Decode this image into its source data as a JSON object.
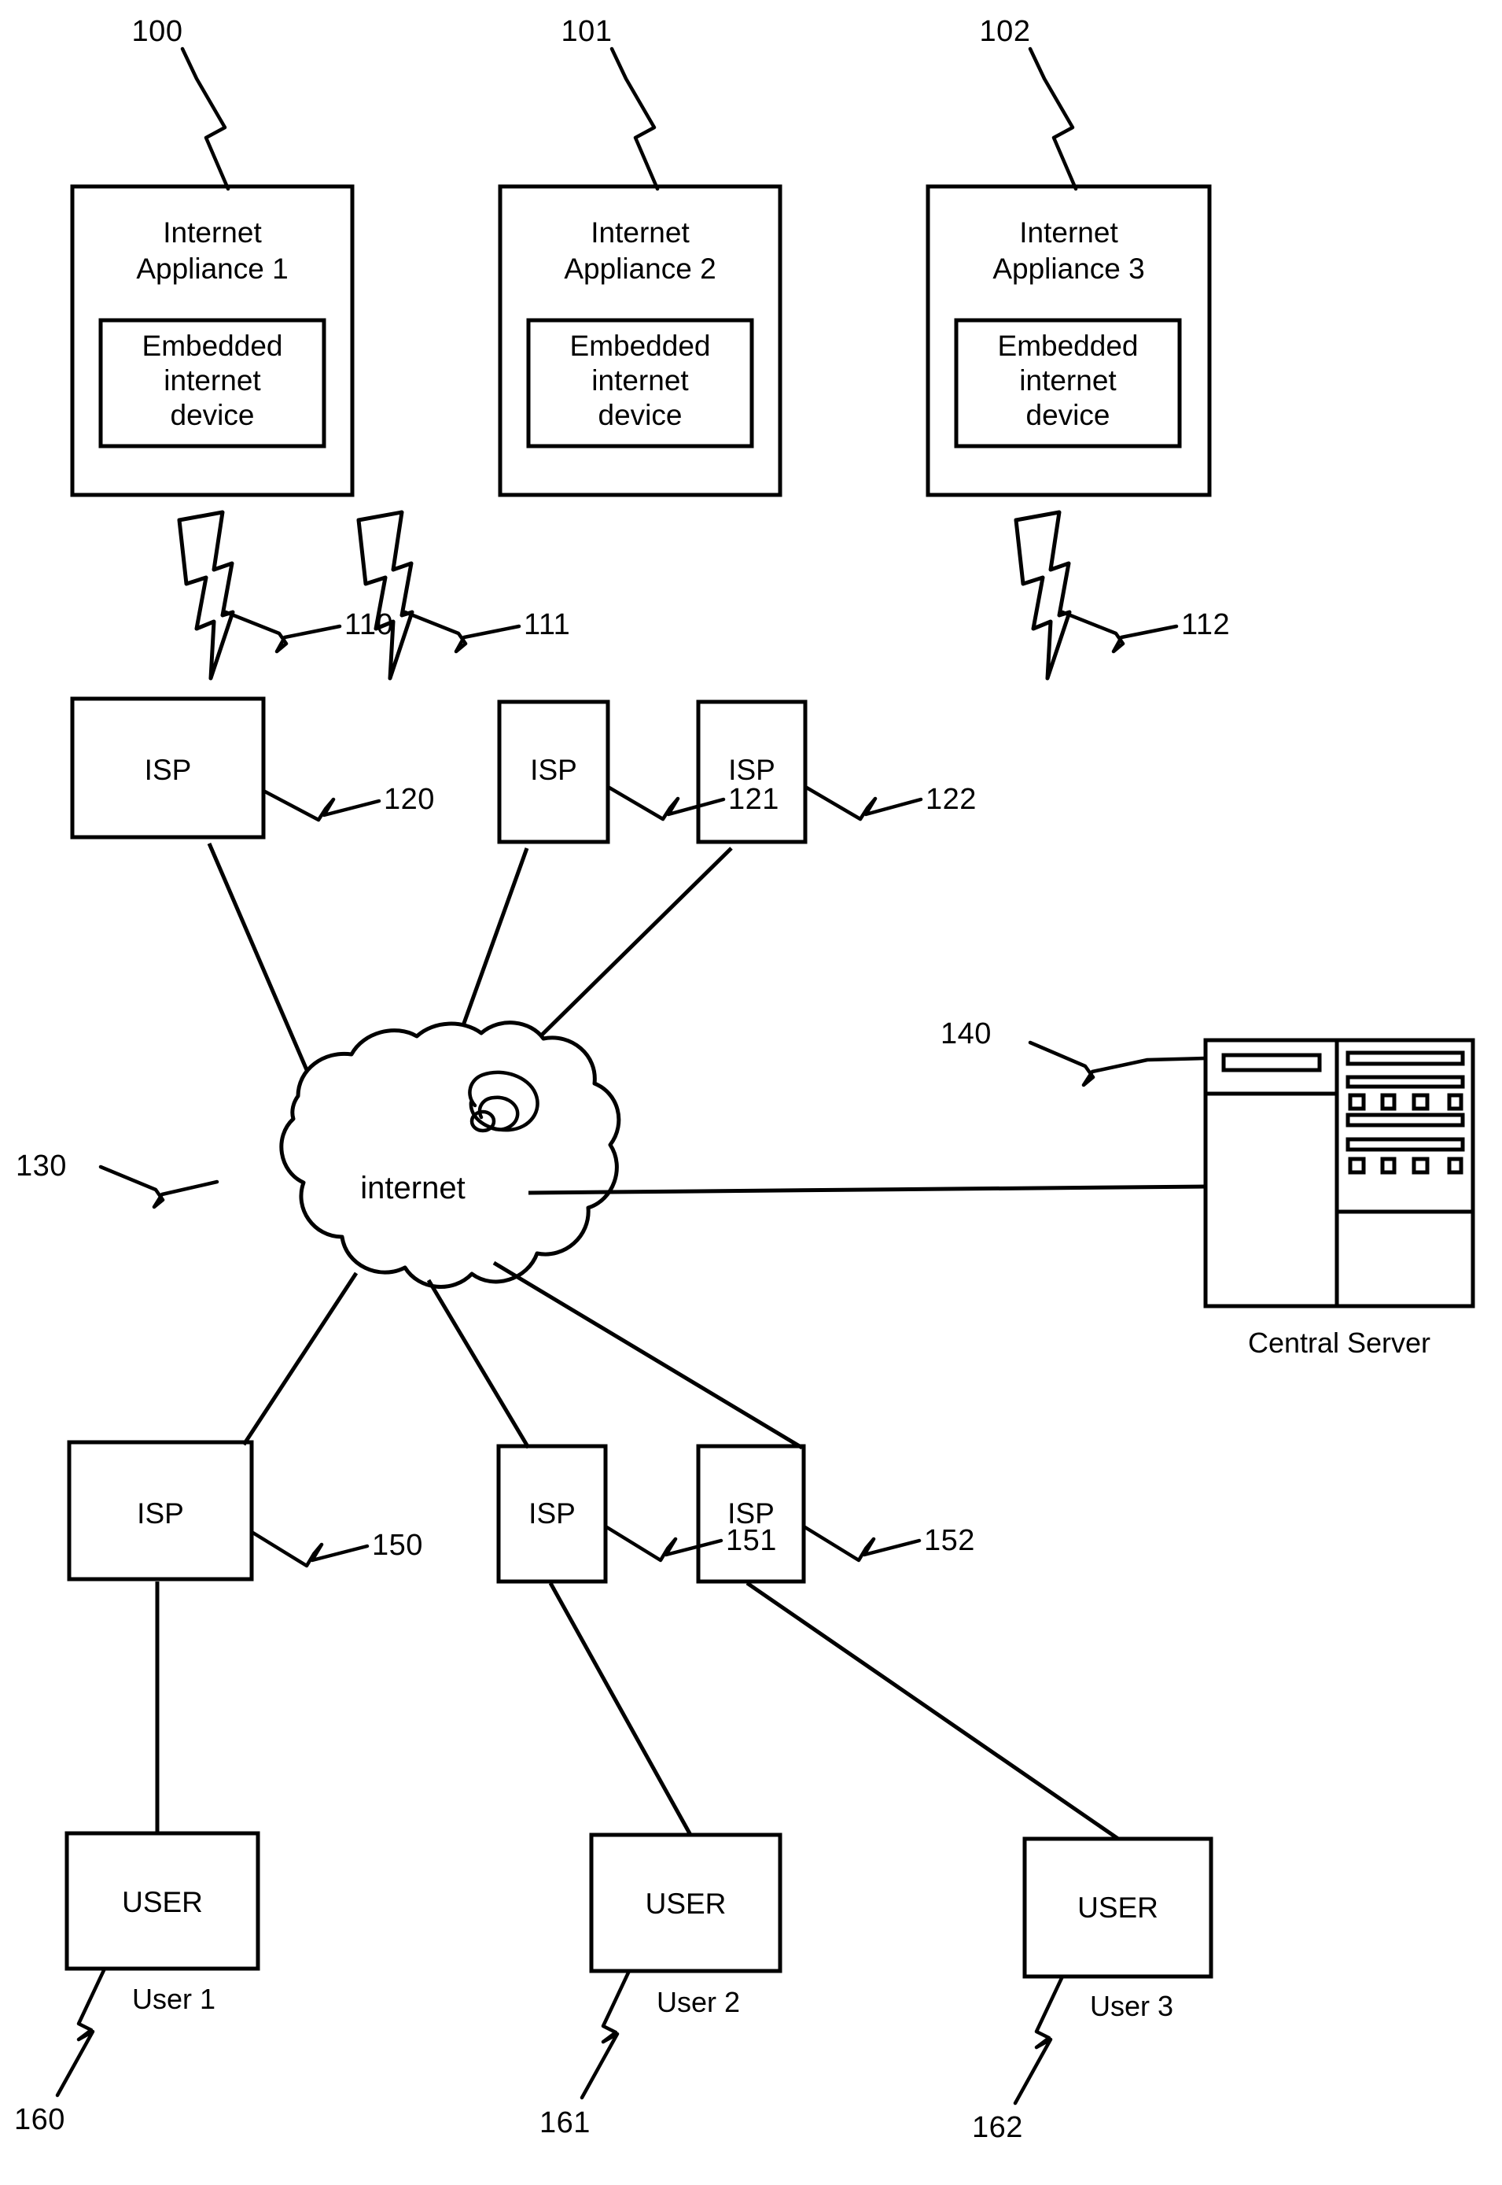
{
  "figure": {
    "kind": "patent-network-diagram",
    "ink_color": "#000000",
    "background_color": "#ffffff"
  },
  "appliances": [
    {
      "ref": "100",
      "title_line1": "Internet",
      "title_line2": "Appliance 1",
      "inner_line1": "Embedded",
      "inner_line2": "internet",
      "inner_line3": "device"
    },
    {
      "ref": "101",
      "title_line1": "Internet",
      "title_line2": "Appliance 2",
      "inner_line1": "Embedded",
      "inner_line2": "internet",
      "inner_line3": "device"
    },
    {
      "ref": "102",
      "title_line1": "Internet",
      "title_line2": "Appliance 3",
      "inner_line1": "Embedded",
      "inner_line2": "internet",
      "inner_line3": "device"
    }
  ],
  "wireless_links": [
    {
      "ref": "110"
    },
    {
      "ref": "111"
    },
    {
      "ref": "112"
    }
  ],
  "upper_isps": [
    {
      "label": "ISP",
      "ref": "120"
    },
    {
      "label": "ISP",
      "ref": "121"
    },
    {
      "label": "ISP",
      "ref": "122"
    }
  ],
  "cloud": {
    "label": "internet",
    "ref": "130"
  },
  "central_server": {
    "ref": "140",
    "caption": "Central Server"
  },
  "lower_isps": [
    {
      "label": "ISP",
      "ref": "150"
    },
    {
      "label": "ISP",
      "ref": "151"
    },
    {
      "label": "ISP",
      "ref": "152"
    }
  ],
  "users": [
    {
      "label": "USER",
      "caption": "User 1",
      "ref": "160"
    },
    {
      "label": "USER",
      "caption": "User 2",
      "ref": "161"
    },
    {
      "label": "USER",
      "caption": "User 3",
      "ref": "162"
    }
  ]
}
